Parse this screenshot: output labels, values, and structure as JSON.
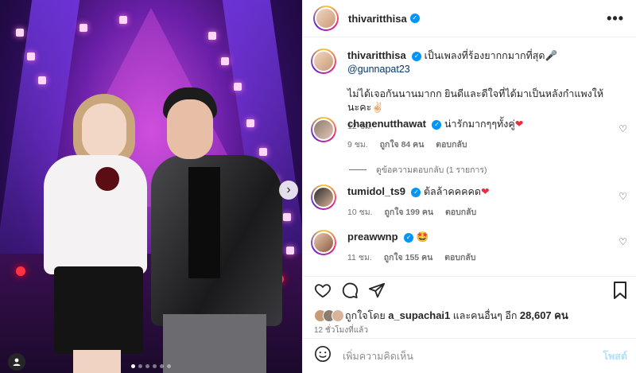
{
  "post": {
    "photo": {
      "carousel_count": 6,
      "carousel_active": 0
    }
  },
  "header": {
    "username": "thivaritthisa",
    "more_label": "•••"
  },
  "caption": {
    "username": "thivaritthisa",
    "text": "เป็นเพลงที่ร้องยากกมากที่สุด🎤",
    "mention": "@gunnapat23",
    "body": "ไม่ได้เจอกันนานมากก ยินดีและดีใจที่ได้มาเป็นหลังกำแพงให้นะคะ✌🏻",
    "time": "12 ชม."
  },
  "comments": [
    {
      "username": "chanenutthawat",
      "text": "น่ารักมากๆๆทั้งคู่",
      "emoji": "❤",
      "time": "9 ชม.",
      "likes": "ถูกใจ 84 คน",
      "reply": "ตอบกลับ"
    },
    {
      "username": "tumidol_ts9",
      "text": "ต้ลล้าคคคคด",
      "emoji": "❤",
      "time": "10 ชม.",
      "likes": "ถูกใจ 199 คน",
      "reply": "ตอบกลับ"
    },
    {
      "username": "preawwnp",
      "text": "🤩",
      "emoji": "",
      "time": "11 ชม.",
      "likes": "ถูกใจ 155 คน",
      "reply": "ตอบกลับ"
    }
  ],
  "view_replies": "ดูข้อความตอบกลับ (1 รายการ)",
  "likes_line": {
    "prefix": "ถูกใจโดย",
    "user": "a_supachai1",
    "middle": "และคนอื่นๆ อีก",
    "count": "28,607",
    "suffix": "คน"
  },
  "time_ago": "12 ชั่วโมงที่แล้ว",
  "add_comment": {
    "placeholder": "เพิ่มความคิดเห็น",
    "post_label": "โพสต์"
  },
  "colors": {
    "verified": "#0095f6",
    "heart": "#ed2b41",
    "post_disabled": "#b2dffc"
  }
}
